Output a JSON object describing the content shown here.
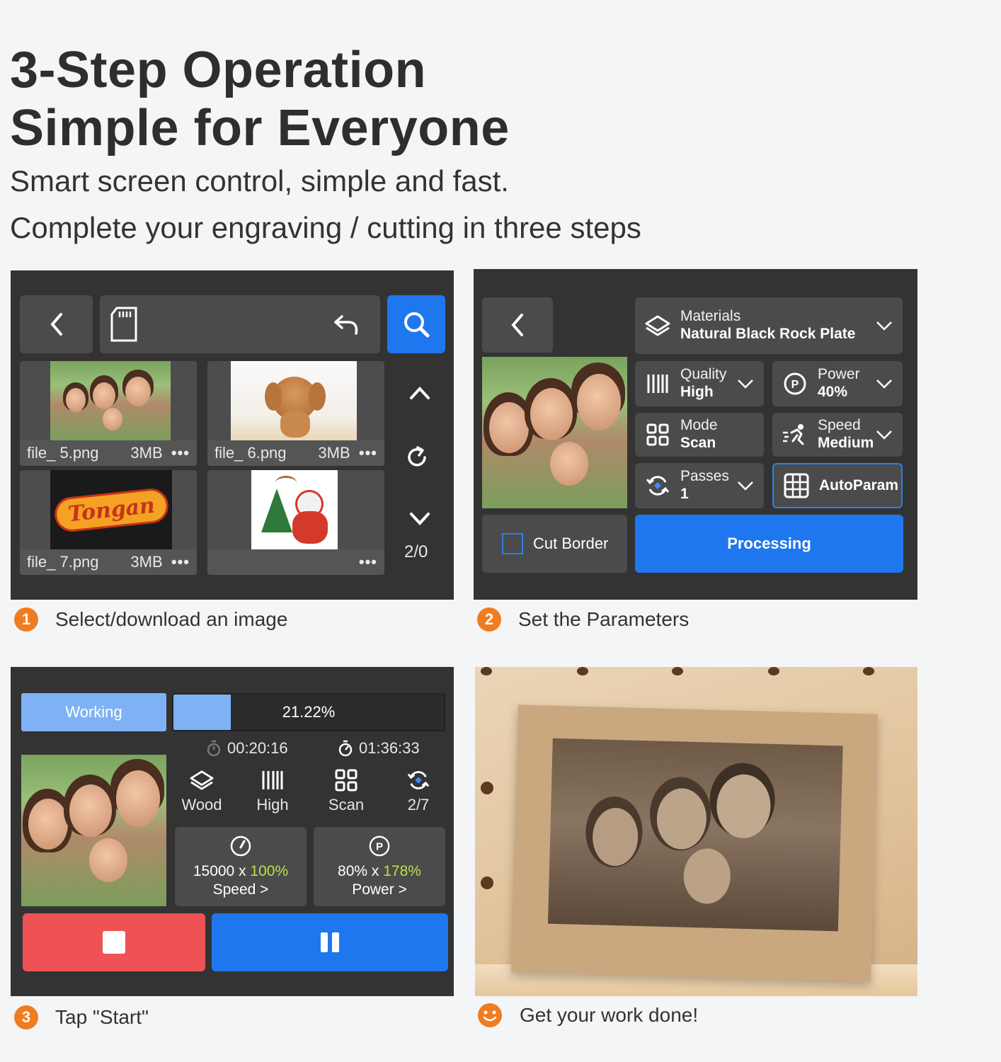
{
  "header": {
    "title_line1": "3-Step Operation",
    "title_line2": "Simple for Everyone",
    "subtitle_line1": "Smart screen control, simple and fast.",
    "subtitle_line2": "Complete your engraving / cutting in three steps"
  },
  "step1": {
    "number": "1",
    "label": "Select/download an image",
    "pager": "2/0",
    "files": [
      {
        "name": "file_ 5.png",
        "size": "3MB",
        "more": "•••"
      },
      {
        "name": "file_ 6.png",
        "size": "3MB",
        "more": "•••"
      },
      {
        "name": "file_ 7.png",
        "size": "3MB",
        "more": "•••"
      },
      {
        "name": "",
        "size": "",
        "more": "•••"
      }
    ],
    "logo_text": "Tongan"
  },
  "step2": {
    "number": "2",
    "label": "Set the Parameters",
    "materials_label": "Materials",
    "materials_value": "Natural Black Rock Plate",
    "quality_label": "Quality",
    "quality_value": "High",
    "power_label": "Power",
    "power_value": "40%",
    "mode_label": "Mode",
    "mode_value": "Scan",
    "speed_label": "Speed",
    "speed_value": "Medium",
    "passes_label": "Passes",
    "passes_value": "1",
    "autoparam_label": "AutoParam",
    "cut_border_label": "Cut Border",
    "processing_label": "Processing"
  },
  "step3": {
    "number": "3",
    "label": "Tap \"Start\"",
    "status": "Working",
    "progress_text": "21.22%",
    "progress_value": 0.2122,
    "elapsed": "00:20:16",
    "remaining": "01:36:33",
    "material": "Wood",
    "quality": "High",
    "mode": "Scan",
    "passes": "2/7",
    "speed_base": "15000 x ",
    "speed_pct": "100%",
    "speed_label": "Speed >",
    "power_base": "80% x ",
    "power_pct": "178%",
    "power_label": "Power >"
  },
  "step4": {
    "label": "Get your work done!"
  },
  "colors": {
    "accent_blue": "#1f77f0",
    "panel_dark": "#333333",
    "stop_red": "#ef5254",
    "step_orange": "#f07c20"
  }
}
